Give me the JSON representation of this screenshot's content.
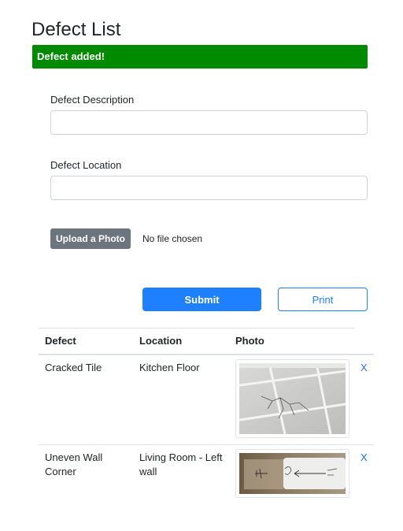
{
  "page": {
    "title": "Defect List"
  },
  "alert": {
    "message": "Defect added!"
  },
  "form": {
    "description": {
      "label": "Defect Description",
      "value": ""
    },
    "location": {
      "label": "Defect Location",
      "value": ""
    },
    "upload": {
      "button_label": "Upload a Photo",
      "status": "No file chosen"
    },
    "submit_label": "Submit",
    "print_label": "Print"
  },
  "table": {
    "headers": {
      "defect": "Defect",
      "location": "Location",
      "photo": "Photo"
    },
    "rows": [
      {
        "defect": "Cracked Tile",
        "location": "Kitchen Floor",
        "photo_icon": "cracked-tile-photo",
        "delete_label": "X"
      },
      {
        "defect": "Uneven Wall Corner",
        "location": "Living Room - Left wall",
        "photo_icon": "wall-corner-photo",
        "delete_label": "X"
      }
    ]
  },
  "colors": {
    "alert_bg": "#008a00",
    "primary": "#1e80ff",
    "secondary_button": "#6c757d",
    "link": "#1e6fd9"
  }
}
